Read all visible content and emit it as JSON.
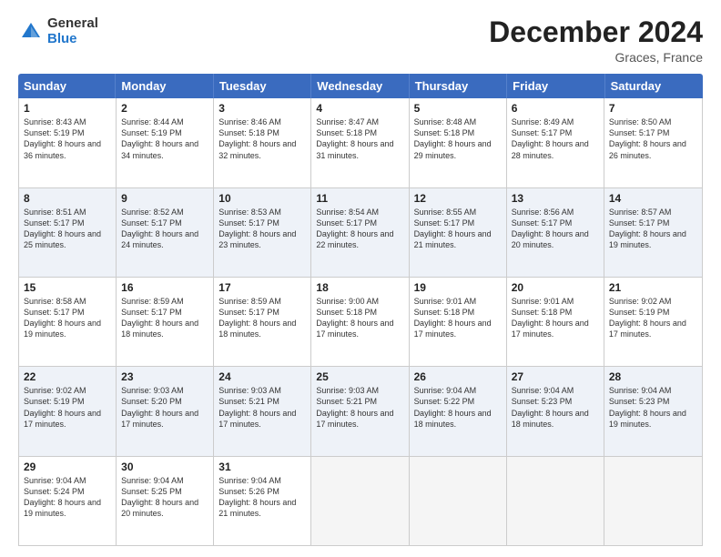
{
  "logo": {
    "general": "General",
    "blue": "Blue"
  },
  "title": "December 2024",
  "location": "Graces, France",
  "days": [
    "Sunday",
    "Monday",
    "Tuesday",
    "Wednesday",
    "Thursday",
    "Friday",
    "Saturday"
  ],
  "weeks": [
    [
      {
        "day": "1",
        "sunrise": "8:43 AM",
        "sunset": "5:19 PM",
        "daylight": "8 hours and 36 minutes."
      },
      {
        "day": "2",
        "sunrise": "8:44 AM",
        "sunset": "5:19 PM",
        "daylight": "8 hours and 34 minutes."
      },
      {
        "day": "3",
        "sunrise": "8:46 AM",
        "sunset": "5:18 PM",
        "daylight": "8 hours and 32 minutes."
      },
      {
        "day": "4",
        "sunrise": "8:47 AM",
        "sunset": "5:18 PM",
        "daylight": "8 hours and 31 minutes."
      },
      {
        "day": "5",
        "sunrise": "8:48 AM",
        "sunset": "5:18 PM",
        "daylight": "8 hours and 29 minutes."
      },
      {
        "day": "6",
        "sunrise": "8:49 AM",
        "sunset": "5:17 PM",
        "daylight": "8 hours and 28 minutes."
      },
      {
        "day": "7",
        "sunrise": "8:50 AM",
        "sunset": "5:17 PM",
        "daylight": "8 hours and 26 minutes."
      }
    ],
    [
      {
        "day": "8",
        "sunrise": "8:51 AM",
        "sunset": "5:17 PM",
        "daylight": "8 hours and 25 minutes."
      },
      {
        "day": "9",
        "sunrise": "8:52 AM",
        "sunset": "5:17 PM",
        "daylight": "8 hours and 24 minutes."
      },
      {
        "day": "10",
        "sunrise": "8:53 AM",
        "sunset": "5:17 PM",
        "daylight": "8 hours and 23 minutes."
      },
      {
        "day": "11",
        "sunrise": "8:54 AM",
        "sunset": "5:17 PM",
        "daylight": "8 hours and 22 minutes."
      },
      {
        "day": "12",
        "sunrise": "8:55 AM",
        "sunset": "5:17 PM",
        "daylight": "8 hours and 21 minutes."
      },
      {
        "day": "13",
        "sunrise": "8:56 AM",
        "sunset": "5:17 PM",
        "daylight": "8 hours and 20 minutes."
      },
      {
        "day": "14",
        "sunrise": "8:57 AM",
        "sunset": "5:17 PM",
        "daylight": "8 hours and 19 minutes."
      }
    ],
    [
      {
        "day": "15",
        "sunrise": "8:58 AM",
        "sunset": "5:17 PM",
        "daylight": "8 hours and 19 minutes."
      },
      {
        "day": "16",
        "sunrise": "8:59 AM",
        "sunset": "5:17 PM",
        "daylight": "8 hours and 18 minutes."
      },
      {
        "day": "17",
        "sunrise": "8:59 AM",
        "sunset": "5:17 PM",
        "daylight": "8 hours and 18 minutes."
      },
      {
        "day": "18",
        "sunrise": "9:00 AM",
        "sunset": "5:18 PM",
        "daylight": "8 hours and 17 minutes."
      },
      {
        "day": "19",
        "sunrise": "9:01 AM",
        "sunset": "5:18 PM",
        "daylight": "8 hours and 17 minutes."
      },
      {
        "day": "20",
        "sunrise": "9:01 AM",
        "sunset": "5:18 PM",
        "daylight": "8 hours and 17 minutes."
      },
      {
        "day": "21",
        "sunrise": "9:02 AM",
        "sunset": "5:19 PM",
        "daylight": "8 hours and 17 minutes."
      }
    ],
    [
      {
        "day": "22",
        "sunrise": "9:02 AM",
        "sunset": "5:19 PM",
        "daylight": "8 hours and 17 minutes."
      },
      {
        "day": "23",
        "sunrise": "9:03 AM",
        "sunset": "5:20 PM",
        "daylight": "8 hours and 17 minutes."
      },
      {
        "day": "24",
        "sunrise": "9:03 AM",
        "sunset": "5:21 PM",
        "daylight": "8 hours and 17 minutes."
      },
      {
        "day": "25",
        "sunrise": "9:03 AM",
        "sunset": "5:21 PM",
        "daylight": "8 hours and 17 minutes."
      },
      {
        "day": "26",
        "sunrise": "9:04 AM",
        "sunset": "5:22 PM",
        "daylight": "8 hours and 18 minutes."
      },
      {
        "day": "27",
        "sunrise": "9:04 AM",
        "sunset": "5:23 PM",
        "daylight": "8 hours and 18 minutes."
      },
      {
        "day": "28",
        "sunrise": "9:04 AM",
        "sunset": "5:23 PM",
        "daylight": "8 hours and 19 minutes."
      }
    ],
    [
      {
        "day": "29",
        "sunrise": "9:04 AM",
        "sunset": "5:24 PM",
        "daylight": "8 hours and 19 minutes."
      },
      {
        "day": "30",
        "sunrise": "9:04 AM",
        "sunset": "5:25 PM",
        "daylight": "8 hours and 20 minutes."
      },
      {
        "day": "31",
        "sunrise": "9:04 AM",
        "sunset": "5:26 PM",
        "daylight": "8 hours and 21 minutes."
      },
      null,
      null,
      null,
      null
    ]
  ]
}
